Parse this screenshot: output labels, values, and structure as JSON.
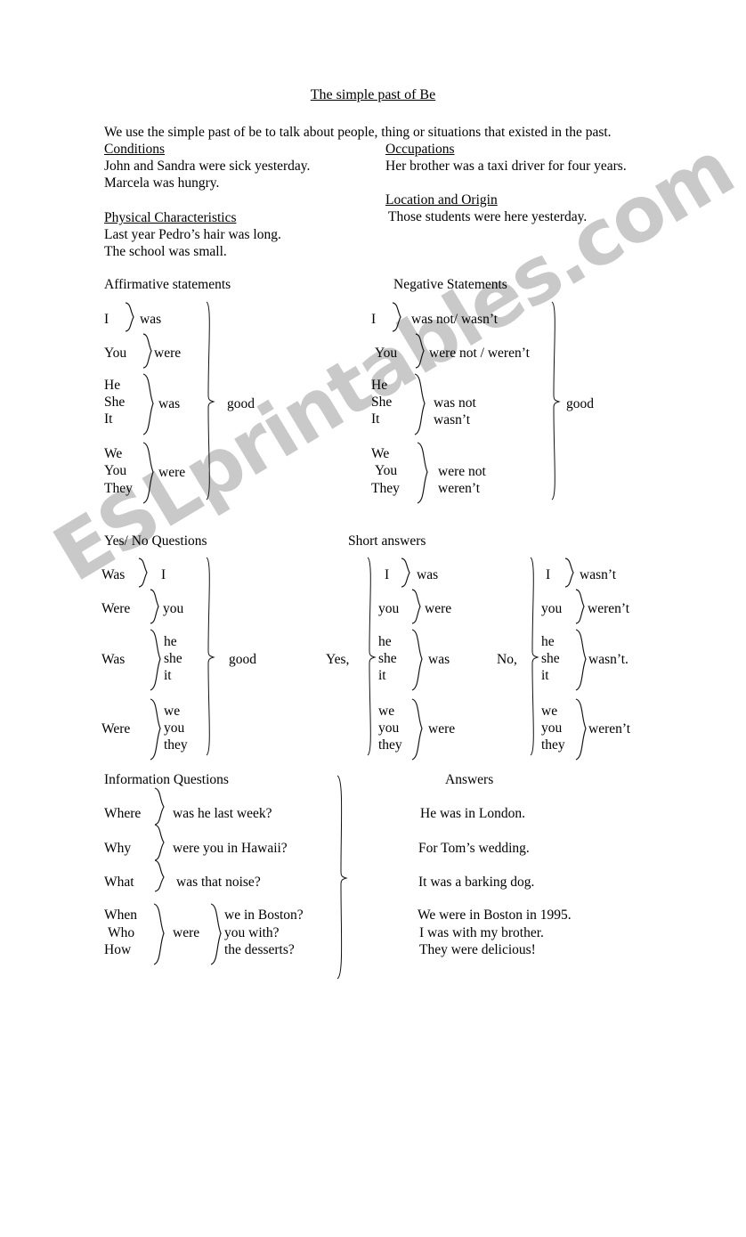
{
  "document": {
    "title": "The simple past of Be",
    "intro": "We use the simple past of be to talk about people, thing or situations that existed in the past."
  },
  "watermark": {
    "text": "ESLprintables.com",
    "color": "#c9c9c9"
  },
  "usage": {
    "conditions": {
      "heading": "Conditions",
      "examples": [
        "John and Sandra were sick yesterday.",
        "Marcela was hungry."
      ]
    },
    "physical_characteristics": {
      "heading": "Physical Characteristics",
      "examples": [
        "Last year Pedro’s hair was long.",
        "The school was small."
      ]
    },
    "occupations": {
      "heading": "Occupations",
      "examples": [
        "Her brother was a taxi driver for four years."
      ]
    },
    "location_and_origin": {
      "heading": "Location and Origin",
      "examples": [
        "Those students were here yesterday."
      ]
    }
  },
  "affirmative": {
    "heading": "Affirmative statements",
    "complement": "good",
    "rows": [
      {
        "subjects": [
          "I"
        ],
        "verb": "was"
      },
      {
        "subjects": [
          "You"
        ],
        "verb": "were"
      },
      {
        "subjects": [
          "He",
          "She",
          "It"
        ],
        "verb": "was"
      },
      {
        "subjects": [
          "We",
          "You",
          "They"
        ],
        "verb": "were"
      }
    ]
  },
  "negative": {
    "heading": "Negative Statements",
    "complement": "good",
    "rows": [
      {
        "subjects": [
          "I"
        ],
        "verb": "was not/ wasn’t"
      },
      {
        "subjects": [
          "You"
        ],
        "verb": "were not / weren’t"
      },
      {
        "subjects": [
          "He",
          "She",
          "It"
        ],
        "verb": "was not",
        "verb2": "wasn’t"
      },
      {
        "subjects": [
          "We",
          "You",
          "They"
        ],
        "verb": "were not",
        "verb2": "weren’t"
      }
    ]
  },
  "yes_no_questions": {
    "heading": "Yes/ No Questions",
    "complement": "good",
    "rows": [
      {
        "verb": "Was",
        "subjects": [
          "I"
        ]
      },
      {
        "verb": "Were",
        "subjects": [
          "you"
        ]
      },
      {
        "verb": "Was",
        "subjects": [
          "he",
          "she",
          "it"
        ]
      },
      {
        "verb": "Were",
        "subjects": [
          "we",
          "you",
          "they"
        ]
      }
    ]
  },
  "short_answers": {
    "heading": "Short answers",
    "affirmative": {
      "lead": "Yes,",
      "rows": [
        {
          "subjects": [
            "I"
          ],
          "verb": "was"
        },
        {
          "subjects": [
            "you"
          ],
          "verb": "were"
        },
        {
          "subjects": [
            "he",
            "she",
            "it"
          ],
          "verb": "was"
        },
        {
          "subjects": [
            "we",
            "you",
            "they"
          ],
          "verb": "were"
        }
      ]
    },
    "negative": {
      "lead": "No,",
      "rows": [
        {
          "subjects": [
            "I"
          ],
          "verb": "wasn’t"
        },
        {
          "subjects": [
            "you"
          ],
          "verb": "weren’t"
        },
        {
          "subjects": [
            "he",
            "she",
            "it"
          ],
          "verb": "wasn’t."
        },
        {
          "subjects": [
            "we",
            "you",
            "they"
          ],
          "verb": "weren’t"
        }
      ]
    }
  },
  "information_questions": {
    "heading": "Information Questions",
    "simple_rows": [
      {
        "wh": "Where",
        "rest": "was he last week?"
      },
      {
        "wh": "Why",
        "rest": "were you in Hawaii?"
      },
      {
        "wh": "What",
        "rest": "was that noise?"
      }
    ],
    "group_row": {
      "wh": [
        "When",
        "Who",
        "How"
      ],
      "verb": "were",
      "rest": [
        "we in Boston?",
        "you with?",
        "the desserts?"
      ]
    }
  },
  "answers": {
    "heading": "Answers",
    "items": [
      "He was in London.",
      "For Tom’s wedding.",
      "It was a barking dog.",
      "We were in Boston in 1995.",
      "I was with my brother.",
      "They were delicious!"
    ]
  }
}
